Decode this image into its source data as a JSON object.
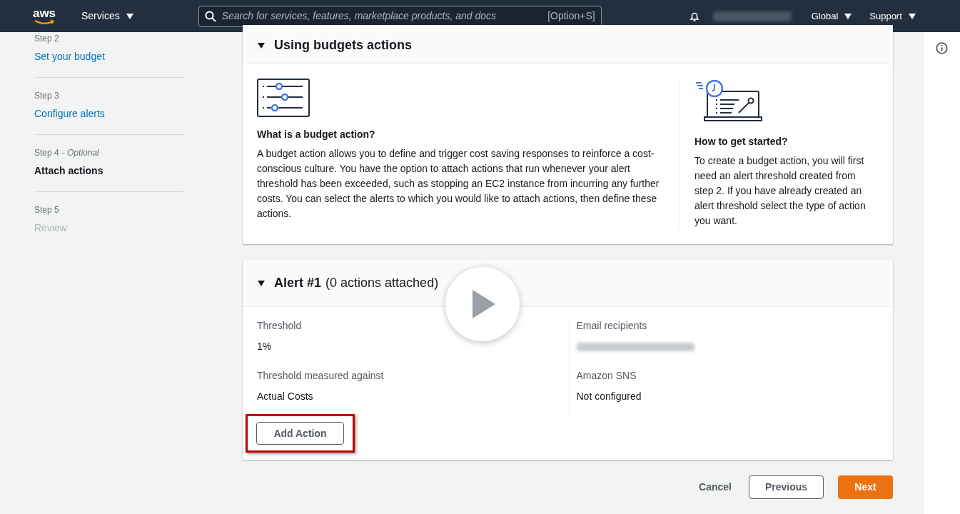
{
  "top_bar": {
    "logo": "aws",
    "services": "Services",
    "search": {
      "placeholder": "Search for services, features, marketplace products, and docs",
      "shortcut": "[Option+S]"
    },
    "region": "Global",
    "support": "Support"
  },
  "steps": [
    {
      "label": "Step 2",
      "title": "Set your budget",
      "kind": "link"
    },
    {
      "label": "Step 3",
      "title": "Configure alerts",
      "kind": "link"
    },
    {
      "label": "Step 4",
      "optional": "- Optional",
      "title": "Attach actions",
      "kind": "current"
    },
    {
      "label": "Step 5",
      "title": "Review",
      "kind": "disabled"
    }
  ],
  "info_panel": {
    "title": "Using budgets actions",
    "expanded": true,
    "left": {
      "heading": "What is a budget action?",
      "text": "A budget action allows you to define and trigger cost saving responses to reinforce a cost-conscious culture. You have the option to attach actions that run whenever your alert threshold has been exceeded, such as stopping an EC2 instance from incurring any further costs. You can select the alerts to which you would like to attach actions, then define these actions."
    },
    "right": {
      "heading": "How to get started?",
      "text": "To create a budget action, you will first need an alert threshold created from step 2. If you have already created an alert threshold select the type of action you want."
    }
  },
  "alert": {
    "title": "Alert #1",
    "count": "(0 actions attached)",
    "expanded": true,
    "fields": [
      {
        "label": "Threshold",
        "value": "1%"
      },
      {
        "label": "Email recipients"
      },
      {
        "label": "Threshold measured against",
        "value": "Actual Costs"
      },
      {
        "label": "Amazon SNS",
        "value": "Not configured"
      }
    ],
    "button": "Add Action"
  },
  "footer": {
    "cancel": "Cancel",
    "previous": "Previous",
    "next": "Next"
  }
}
